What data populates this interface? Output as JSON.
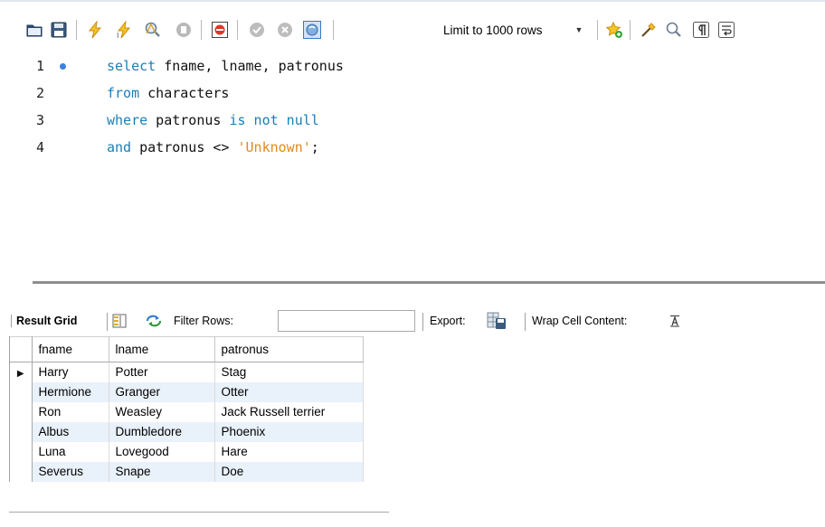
{
  "toolbar": {
    "icons": [
      {
        "name": "open-folder-icon",
        "x": 0
      },
      {
        "name": "save-icon",
        "x": 0
      },
      {
        "name": "execute-icon",
        "x": 0
      },
      {
        "name": "execute-current-icon",
        "x": 0
      },
      {
        "name": "explain-icon",
        "x": 0
      },
      {
        "name": "stop-icon",
        "x": 0
      },
      {
        "name": "toggle-error-icon",
        "x": 0
      },
      {
        "name": "commit-icon",
        "x": 0
      },
      {
        "name": "rollback-icon",
        "x": 0
      },
      {
        "name": "autocommit-icon",
        "x": 0
      },
      {
        "name": "favorite-snippet-icon",
        "x": 0
      },
      {
        "name": "beautify-icon",
        "x": 0
      },
      {
        "name": "find-icon",
        "x": 0
      },
      {
        "name": "invisible-chars-icon",
        "x": 0
      },
      {
        "name": "word-wrap-icon",
        "x": 0
      }
    ],
    "limit_select": "Limit to 1000 rows"
  },
  "editor": {
    "lines": [
      {
        "number": "1",
        "tokens": [
          [
            "kw",
            "select"
          ],
          [
            "id",
            " fname, lname, patronus"
          ]
        ]
      },
      {
        "number": "2",
        "tokens": [
          [
            "kw",
            "from"
          ],
          [
            "id",
            " characters"
          ]
        ]
      },
      {
        "number": "3",
        "tokens": [
          [
            "kw",
            "where"
          ],
          [
            "id",
            " patronus "
          ],
          [
            "kw",
            "is not null"
          ]
        ]
      },
      {
        "number": "4",
        "tokens": [
          [
            "kw",
            "and"
          ],
          [
            "id",
            " patronus <> "
          ],
          [
            "str",
            "'Unknown'"
          ],
          [
            "op",
            ";"
          ]
        ]
      }
    ]
  },
  "results_toolbar": {
    "result_grid_label": "Result Grid",
    "filter_label": "Filter Rows:",
    "filter_value": "",
    "export_label": "Export:",
    "wrap_label": "Wrap Cell Content:"
  },
  "grid": {
    "columns": [
      "fname",
      "lname",
      "patronus"
    ],
    "rows": [
      [
        "Harry",
        "Potter",
        "Stag"
      ],
      [
        "Hermione",
        "Granger",
        "Otter"
      ],
      [
        "Ron",
        "Weasley",
        "Jack Russell terrier"
      ],
      [
        "Albus",
        "Dumbledore",
        "Phoenix"
      ],
      [
        "Luna",
        "Lovegood",
        "Hare"
      ],
      [
        "Severus",
        "Snape",
        "Doe"
      ]
    ]
  }
}
